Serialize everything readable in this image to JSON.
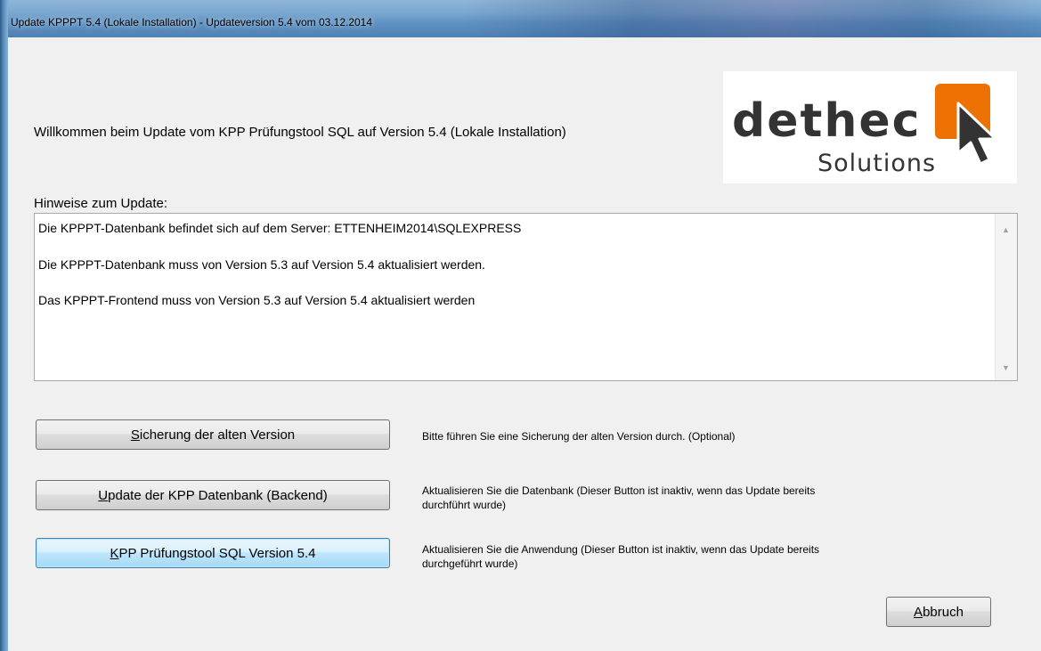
{
  "window": {
    "title": "Update KPPPT 5.4 (Lokale Installation) - Updateversion 5.4 vom 03.12.2014"
  },
  "welcome_text": "Willkommen beim Update vom KPP Prüfungstool SQL auf Version 5.4 (Lokale Installation)",
  "logo": {
    "word": "dethec",
    "sub": "Solutions",
    "accent_color": "#ee7203"
  },
  "hints": {
    "label": "Hinweise zum Update:",
    "lines": [
      "Die KPPPT-Datenbank befindet sich auf dem Server: ETTENHEIM2014\\SQLEXPRESS",
      "Die KPPPT-Datenbank muss von Version 5.3 auf Version 5.4 aktualisiert werden.",
      "Das KPPPT-Frontend muss von Version 5.3 auf Version 5.4 aktualisiert werden"
    ]
  },
  "actions": [
    {
      "label_first": "S",
      "label_rest": "icherung der alten Version",
      "description": "Bitte führen Sie eine Sicherung der alten Version durch. (Optional)"
    },
    {
      "label_first": "U",
      "label_rest": "pdate der KPP Datenbank (Backend)",
      "description": "Aktualisieren Sie die Datenbank (Dieser Button ist inaktiv, wenn das Update bereits durchführt wurde)"
    },
    {
      "label_first": "K",
      "label_rest": "PP Prüfungstool SQL Version 5.4",
      "description": "Aktualisieren Sie die Anwendung (Dieser Button ist inaktiv, wenn das Update bereits durchgeführt wurde)"
    }
  ],
  "cancel": {
    "label_first": "A",
    "label_rest": "bbruch"
  }
}
